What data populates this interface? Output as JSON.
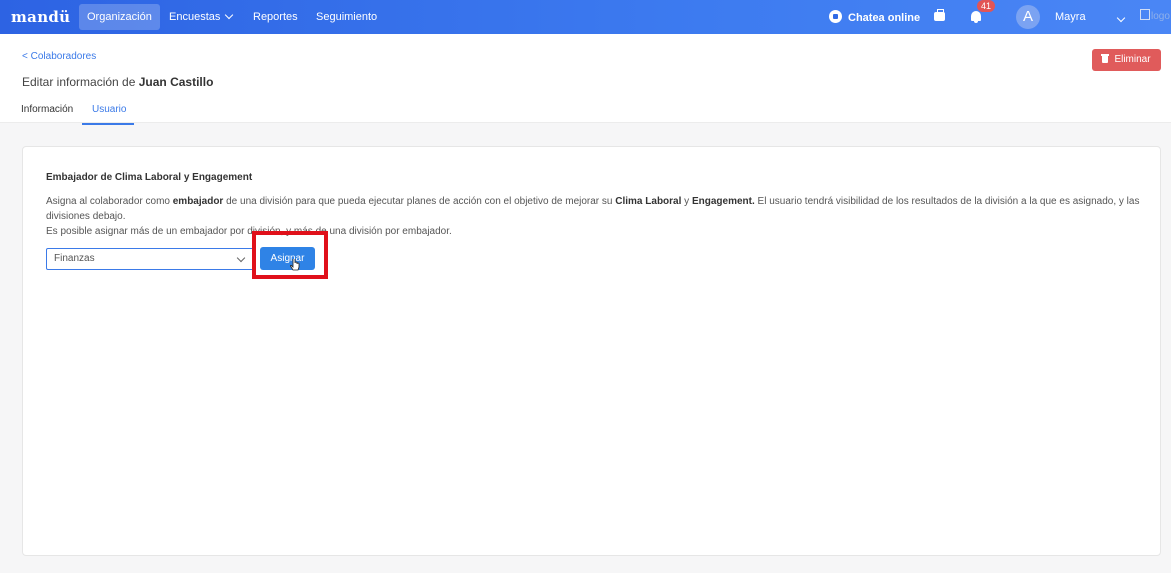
{
  "topbar": {
    "brand": "mandü",
    "nav": [
      {
        "label": "Organización",
        "active": true
      },
      {
        "label": "Encuestas",
        "dropdown": true
      },
      {
        "label": "Reportes"
      },
      {
        "label": "Seguimiento"
      }
    ],
    "chat_label": "Chatea online",
    "notifications_count": "41",
    "avatar_letter": "A",
    "user_name": "Mayra",
    "logo_alt": "logo",
    "colors": {
      "bar": "#2f6ae6",
      "badge": "#e25555"
    }
  },
  "header": {
    "back_label": "Colaboradores",
    "title_prefix": "Editar información de",
    "title_name": "Juan Castillo",
    "delete_label": "Eliminar",
    "tabs": [
      {
        "label": "Información",
        "active": false
      },
      {
        "label": "Usuario",
        "active": true
      }
    ]
  },
  "card": {
    "title": "Embajador de Clima Laboral y Engagement",
    "desc": {
      "p1": "Asigna al colaborador como ",
      "b1": "embajador",
      "p2": " de una división para que pueda ejecutar planes de acción con el objetivo de mejorar su ",
      "b2": "Clima Laboral",
      "p3": " y ",
      "b3": "Engagement.",
      "p4": " El usuario tendrá visibilidad de los resultados de la división a la que es asignado, y las divisiones debajo.",
      "line2": "Es posible asignar más de un embajador por división, y más de una división por embajador."
    },
    "select_value": "Finanzas",
    "assign_label": "Asignar"
  },
  "accent_color": "#3b7ae8",
  "highlight_color": "#e0101a"
}
